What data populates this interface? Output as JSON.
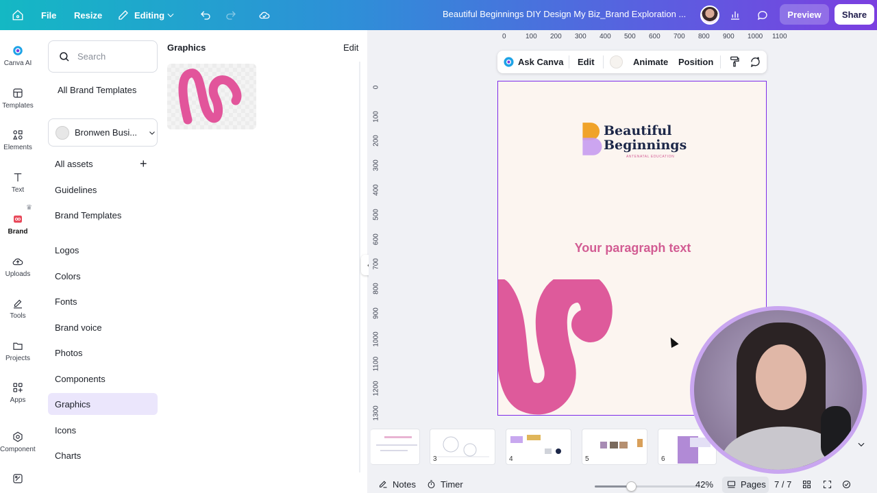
{
  "topbar": {
    "file": "File",
    "resize": "Resize",
    "editing": "Editing",
    "doc_title": "Beautiful Beginnings DIY Design My Biz_Brand Exploration ...",
    "preview": "Preview",
    "share": "Share"
  },
  "rail": {
    "items": [
      {
        "label": "Canva AI",
        "icon": "canva-ai-icon"
      },
      {
        "label": "Templates",
        "icon": "templates-icon"
      },
      {
        "label": "Elements",
        "icon": "elements-icon"
      },
      {
        "label": "Text",
        "icon": "text-icon"
      },
      {
        "label": "Brand",
        "icon": "brand-icon"
      },
      {
        "label": "Uploads",
        "icon": "cloud-upload-icon"
      },
      {
        "label": "Tools",
        "icon": "pen-icon"
      },
      {
        "label": "Projects",
        "icon": "folder-icon"
      },
      {
        "label": "Apps",
        "icon": "apps-icon"
      },
      {
        "label": "Components",
        "icon": "components-icon"
      }
    ]
  },
  "panel": {
    "search_placeholder": "Search",
    "all_brand_templates": "All Brand Templates",
    "brand_kit": "Bronwen Busi...",
    "nav": [
      "All assets",
      "Guidelines",
      "Brand Templates",
      "Logos",
      "Colors",
      "Fonts",
      "Brand voice",
      "Photos",
      "Components",
      "Graphics",
      "Icons",
      "Charts"
    ],
    "active": "Graphics",
    "header": "Graphics",
    "edit": "Edit"
  },
  "ruler": {
    "top": [
      "0",
      "100",
      "200",
      "300",
      "400",
      "500",
      "600",
      "700",
      "800",
      "900",
      "1000",
      "1100"
    ],
    "left": [
      "0",
      "100",
      "200",
      "300",
      "400",
      "500",
      "600",
      "700",
      "800",
      "900",
      "1000",
      "1100",
      "1200",
      "1300"
    ]
  },
  "context_toolbar": {
    "ask_canva": "Ask Canva",
    "edit": "Edit",
    "animate": "Animate",
    "position": "Position"
  },
  "design": {
    "logo_line1": "Beautiful",
    "logo_line2": "Beginnings",
    "logo_tagline": "ANTENATAL EDUCATION",
    "paragraph": "Your paragraph text",
    "colors": {
      "accent": "#d25c93",
      "navy": "#1c2748",
      "background": "#fcf5f0",
      "selection": "#7d2ae8"
    }
  },
  "filmstrip": {
    "pages": [
      "3",
      "4",
      "5",
      "6"
    ]
  },
  "bottombar": {
    "notes": "Notes",
    "timer": "Timer",
    "zoom": "42%",
    "zoom_level": 0.35,
    "pages": "Pages",
    "page_count": "7 / 7"
  }
}
